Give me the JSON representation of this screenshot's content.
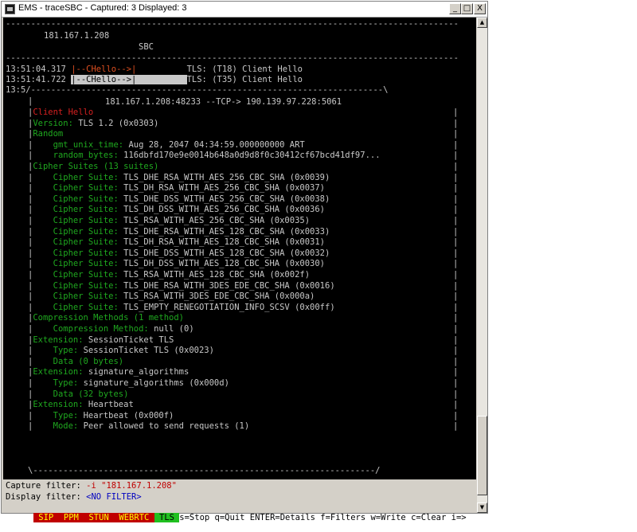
{
  "window": {
    "title": "EMS - traceSBC - Captured: 3  Displayed: 3",
    "buttons": {
      "minimize": "_",
      "maximize": "□",
      "close": "X"
    }
  },
  "header": {
    "ip": "181.167.1.208",
    "label": "SBC"
  },
  "messages": [
    {
      "time": "13:51:04.317",
      "arrow": "|--CHello-->|",
      "proto": "TLS: (T18) Client Hello",
      "selected": false
    },
    {
      "time": "13:51:41.722",
      "arrow": "|--CHello-->|",
      "proto": "TLS: (T35) Client Hello",
      "selected": true
    }
  ],
  "detail": {
    "box_top": "13:5/----------------------------------------------------------------------\\",
    "connection": "181.167.1.208:48233 --TCP-> 190.139.97.228:5061",
    "lines": [
      {
        "text": "Client Hello",
        "color": "r",
        "indent": 0,
        "value": ""
      },
      {
        "text": "Version: ",
        "color": "g",
        "indent": 0,
        "value": "TLS 1.2 (0x0303)"
      },
      {
        "text": "Random",
        "color": "g",
        "indent": 0,
        "value": ""
      },
      {
        "text": "gmt_unix_time: ",
        "color": "g",
        "indent": 1,
        "value": "Aug 28, 2047 04:34:59.000000000 ART"
      },
      {
        "text": "random_bytes: ",
        "color": "g",
        "indent": 1,
        "value": "116dbfd170e9e0014b648a0d9d8f0c30412cf67bcd41df97..."
      },
      {
        "text": "Cipher Suites (13 suites)",
        "color": "g",
        "indent": 0,
        "value": ""
      },
      {
        "text": "Cipher Suite: ",
        "color": "g",
        "indent": 1,
        "value": "TLS_DHE_RSA_WITH_AES_256_CBC_SHA (0x0039)"
      },
      {
        "text": "Cipher Suite: ",
        "color": "g",
        "indent": 1,
        "value": "TLS_DH_RSA_WITH_AES_256_CBC_SHA (0x0037)"
      },
      {
        "text": "Cipher Suite: ",
        "color": "g",
        "indent": 1,
        "value": "TLS_DHE_DSS_WITH_AES_256_CBC_SHA (0x0038)"
      },
      {
        "text": "Cipher Suite: ",
        "color": "g",
        "indent": 1,
        "value": "TLS_DH_DSS_WITH_AES_256_CBC_SHA (0x0036)"
      },
      {
        "text": "Cipher Suite: ",
        "color": "g",
        "indent": 1,
        "value": "TLS_RSA_WITH_AES_256_CBC_SHA (0x0035)"
      },
      {
        "text": "Cipher Suite: ",
        "color": "g",
        "indent": 1,
        "value": "TLS_DHE_RSA_WITH_AES_128_CBC_SHA (0x0033)"
      },
      {
        "text": "Cipher Suite: ",
        "color": "g",
        "indent": 1,
        "value": "TLS_DH_RSA_WITH_AES_128_CBC_SHA (0x0031)"
      },
      {
        "text": "Cipher Suite: ",
        "color": "g",
        "indent": 1,
        "value": "TLS_DHE_DSS_WITH_AES_128_CBC_SHA (0x0032)"
      },
      {
        "text": "Cipher Suite: ",
        "color": "g",
        "indent": 1,
        "value": "TLS_DH_DSS_WITH_AES_128_CBC_SHA (0x0030)"
      },
      {
        "text": "Cipher Suite: ",
        "color": "g",
        "indent": 1,
        "value": "TLS_RSA_WITH_AES_128_CBC_SHA (0x002f)"
      },
      {
        "text": "Cipher Suite: ",
        "color": "g",
        "indent": 1,
        "value": "TLS_DHE_RSA_WITH_3DES_EDE_CBC_SHA (0x0016)"
      },
      {
        "text": "Cipher Suite: ",
        "color": "g",
        "indent": 1,
        "value": "TLS_RSA_WITH_3DES_EDE_CBC_SHA (0x000a)"
      },
      {
        "text": "Cipher Suite: ",
        "color": "g",
        "indent": 1,
        "value": "TLS_EMPTY_RENEGOTIATION_INFO_SCSV (0x00ff)"
      },
      {
        "text": "Compression Methods (1 method)",
        "color": "g",
        "indent": 0,
        "value": ""
      },
      {
        "text": "Compression Method: ",
        "color": "g",
        "indent": 1,
        "value": "null (0)"
      },
      {
        "text": "Extension: ",
        "color": "g",
        "indent": 0,
        "value": "SessionTicket TLS"
      },
      {
        "text": "Type: ",
        "color": "g",
        "indent": 1,
        "value": "SessionTicket TLS (0x0023)"
      },
      {
        "text": "Data (0 bytes)",
        "color": "g",
        "indent": 1,
        "value": ""
      },
      {
        "text": "Extension: ",
        "color": "g",
        "indent": 0,
        "value": "signature_algorithms"
      },
      {
        "text": "Type: ",
        "color": "g",
        "indent": 1,
        "value": "signature_algorithms (0x000d)"
      },
      {
        "text": "Data (32 bytes)",
        "color": "g",
        "indent": 1,
        "value": ""
      },
      {
        "text": "Extension: ",
        "color": "g",
        "indent": 0,
        "value": "Heartbeat"
      },
      {
        "text": "Type: ",
        "color": "g",
        "indent": 1,
        "value": "Heartbeat (0x000f)"
      },
      {
        "text": "Mode: ",
        "color": "g",
        "indent": 1,
        "value": "Peer allowed to send requests (1)"
      }
    ],
    "box_bottom": "\\--------------------------------------------------------------------/"
  },
  "filters": {
    "capture_label": "Capture filter: ",
    "capture_value": "-i \"181.167.1.208\"",
    "display_label": "Display filter: ",
    "display_value": "<NO FILTER>"
  },
  "keybar": {
    "tabs": [
      {
        "label": " SIP ",
        "active": false
      },
      {
        "label": " PPM ",
        "active": false
      },
      {
        "label": " STUN ",
        "active": false
      },
      {
        "label": " WEBRTC ",
        "active": false
      },
      {
        "label": " TLS ",
        "active": true
      }
    ],
    "help": "s=Stop q=Quit ENTER=Details f=Filters w=Write c=Clear i=>"
  },
  "colors": {
    "terminal_bg": "#000000",
    "green": "#1fa81f",
    "red": "#d62020",
    "text": "#c8c8c8",
    "status_bg": "#d4d0c8"
  }
}
